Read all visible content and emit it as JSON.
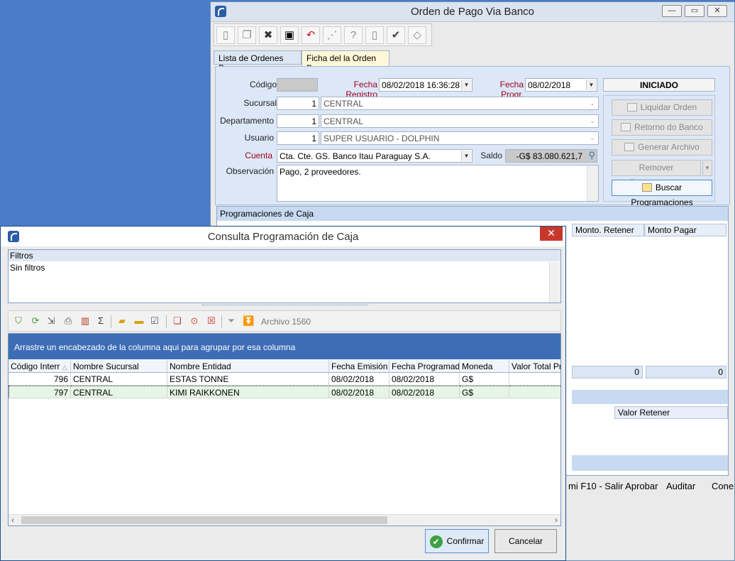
{
  "main_window": {
    "title": "Orden de Pago Via Banco",
    "controls": {
      "minimize": "—",
      "restore": "▭",
      "close": "✕"
    },
    "toolbar": [
      {
        "name": "new-icon",
        "glyph": "▯"
      },
      {
        "name": "copy-icon",
        "glyph": "❐"
      },
      {
        "name": "delete-icon",
        "glyph": "✖"
      },
      {
        "name": "save-icon",
        "glyph": "▣"
      },
      {
        "name": "undo-icon",
        "glyph": "↶"
      },
      {
        "name": "find-icon",
        "glyph": "⋰"
      },
      {
        "name": "help-icon",
        "glyph": "?"
      },
      {
        "name": "exit-icon",
        "glyph": "▯"
      },
      {
        "name": "check-icon",
        "glyph": "✔"
      },
      {
        "name": "eraser-icon",
        "glyph": "◇"
      }
    ],
    "tabs": [
      "Lista de Ordenes Pago",
      "Ficha del la Orden Pago"
    ],
    "form": {
      "codigo_label": "Código",
      "codigo_value": "",
      "fecha_registro_label": "Fecha Registro",
      "fecha_registro_value": "08/02/2018 16:36:28",
      "fecha_prog_label": "Fecha Progr.",
      "fecha_prog_value": "08/02/2018",
      "status": "INICIADO",
      "sucursal_label": "Sucursal",
      "sucursal_id": "1",
      "sucursal_name": "CENTRAL",
      "departamento_label": "Departamento",
      "departamento_id": "1",
      "departamento_name": "CENTRAL",
      "usuario_label": "Usuario",
      "usuario_id": "1",
      "usuario_name": "SUPER USUARIO - DOLPHIN",
      "cuenta_label": "Cuenta",
      "cuenta_value": "Cta. Cte. GS. Banco Itau Paraguay S.A.",
      "saldo_label": "Saldo",
      "saldo_value": "-G$ 83.080.621,7",
      "observacion_label": "Observación",
      "observacion_value": "Pago, 2 proveedores."
    },
    "actions": {
      "liquidar": "Liquidar Orden",
      "retorno": "Retorno do Banco",
      "generar": "Generar Archivo",
      "remover": "Remover Programación",
      "buscar": "Buscar Programaciones"
    },
    "programaciones": {
      "title": "Programaciones de Caja",
      "columns": [
        "Monto. Retener",
        "Monto Pagar"
      ],
      "totals": [
        "0",
        "0"
      ],
      "detail_column": "Valor Retener"
    },
    "status_bar": [
      "mi F10 - Salir Aprobar",
      "Auditar",
      "Cone"
    ]
  },
  "dialog": {
    "title": "Consulta Programación de Caja",
    "close": "✕",
    "filters_label": "Filtros",
    "filters_value": "Sin filtros",
    "toolbar_label": "Archivo 1560",
    "group_hint": "Arrastre un encabezado de la columna aqui para agrupar por esa columna",
    "columns": [
      "Código Interr",
      "Nombre Sucursal",
      "Nombre Entidad",
      "Fecha Emisión",
      "Fecha Programada",
      "Moneda",
      "Valor Total Pro"
    ],
    "rows": [
      [
        "796",
        "CENTRAL",
        "ESTAS TONNE",
        "08/02/2018",
        "08/02/2018",
        "G$",
        ""
      ],
      [
        "797",
        "CENTRAL",
        "KIMI RAIKKONEN",
        "08/02/2018",
        "08/02/2018",
        "G$",
        ""
      ]
    ],
    "confirm": "Confirmar",
    "cancel": "Cancelar"
  }
}
